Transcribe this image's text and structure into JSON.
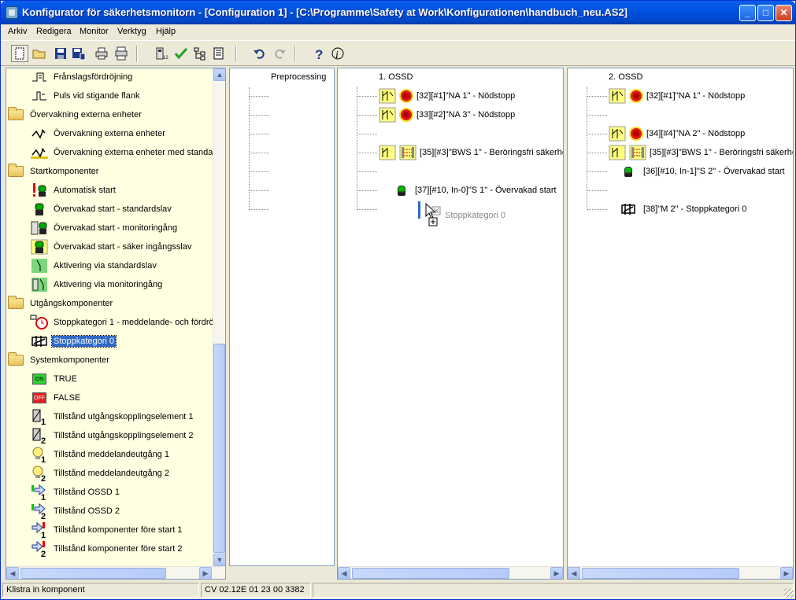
{
  "window": {
    "title": "Konfigurator för säkerhetsmonitorn - [Configuration 1] - [C:\\Programme\\Safety at Work\\Konfigurationen\\handbuch_neu.AS2]",
    "controls": {
      "minimize": "_",
      "maximize": "□",
      "close": "✕"
    }
  },
  "menu": [
    "Arkiv",
    "Redigera",
    "Monitor",
    "Verktyg",
    "Hjälp"
  ],
  "toolbar_icons": [
    "new-icon",
    "open-icon",
    "save-icon",
    "save-as-icon",
    "print-icon",
    "print-preview-icon",
    "monitor-icon",
    "check-icon",
    "tree-icon",
    "report-icon",
    "undo-icon",
    "redo-icon",
    "help-icon",
    "context-help-icon"
  ],
  "tree": {
    "items": [
      {
        "label": "Frånslagsfördröjning",
        "icon": "delay-icon",
        "level": 1
      },
      {
        "label": "Puls vid stigande flank",
        "icon": "pulse-icon",
        "level": 1
      },
      {
        "label": "Övervakning externa enheter",
        "icon": "folder-icon",
        "level": 0
      },
      {
        "label": "Övervakning externa enheter",
        "icon": "ext-monitor-icon",
        "level": 1
      },
      {
        "label": "Övervakning externa enheter med standa",
        "icon": "ext-monitor-std-icon",
        "level": 1
      },
      {
        "label": "Startkomponenter",
        "icon": "folder-icon",
        "level": 0
      },
      {
        "label": "Automatisk start",
        "icon": "auto-start-icon",
        "level": 1
      },
      {
        "label": "Övervakad start - standardslav",
        "icon": "start-light-icon",
        "level": 1
      },
      {
        "label": "Övervakad start - monitoringång",
        "icon": "start-monitor-icon",
        "level": 1
      },
      {
        "label": "Övervakad start - säker ingångsslav",
        "icon": "start-safe-icon",
        "level": 1
      },
      {
        "label": "Aktivering via standardslav",
        "icon": "activation-std-icon",
        "level": 1
      },
      {
        "label": "Aktivering via monitoringång",
        "icon": "activation-monitor-icon",
        "level": 1
      },
      {
        "label": "Utgångskomponenter",
        "icon": "folder-icon",
        "level": 0
      },
      {
        "label": "Stoppkategori 1 - meddelande- och fördrö",
        "icon": "stop-timer-icon",
        "level": 1
      },
      {
        "label": "Stoppkategori 0",
        "icon": "stop-category-icon",
        "level": 1,
        "selected": true
      },
      {
        "label": "Systemkomponenter",
        "icon": "folder-icon",
        "level": 0
      },
      {
        "label": "TRUE",
        "icon": "true-icon",
        "level": 1,
        "badge": "ON"
      },
      {
        "label": "FALSE",
        "icon": "false-icon",
        "level": 1,
        "badge": "OFF"
      },
      {
        "label": "Tillstånd utgångskopplingselement 1",
        "icon": "relay-1-icon",
        "level": 1
      },
      {
        "label": "Tillstånd utgångskopplingselement 2",
        "icon": "relay-2-icon",
        "level": 1
      },
      {
        "label": "Tillstånd meddelandeutgång 1",
        "icon": "bulb-1-icon",
        "level": 1
      },
      {
        "label": "Tillstånd meddelandeutgång 2",
        "icon": "bulb-2-icon",
        "level": 1
      },
      {
        "label": "Tillstånd OSSD 1",
        "icon": "ossd-1-icon",
        "level": 1
      },
      {
        "label": "Tillstånd OSSD 2",
        "icon": "ossd-2-icon",
        "level": 1
      },
      {
        "label": "Tillstånd komponenter före start 1",
        "icon": "prestart-1-icon",
        "level": 1
      },
      {
        "label": "Tillstånd komponenter före start 2",
        "icon": "prestart-2-icon",
        "level": 1
      }
    ]
  },
  "columns": {
    "preprocessing": {
      "title": "Preprocessing"
    },
    "ossd1": {
      "title": "1. OSSD",
      "nodes": [
        "[32][#1]\"NA 1\" - Nödstopp",
        "[33][#2]\"NA 3\" - Nödstopp",
        "[35][#3]\"BWS 1\" - Beröringsfri säkerhe",
        "[37][#10, In-0]\"S 1\" - Övervakad start"
      ],
      "dragging": "Stoppkategori 0"
    },
    "ossd2": {
      "title": "2. OSSD",
      "nodes": [
        "[32][#1]\"NA 1\" - Nödstopp",
        "[34][#4]\"NA 2\" - Nödstopp",
        "[35][#3]\"BWS 1\" - Beröringsfri säkerhe",
        "[36][#10, In-1]\"S 2\" - Övervakad start",
        "[38]\"M 2\" - Stoppkategori 0"
      ]
    }
  },
  "status": {
    "message": "Klistra in komponent",
    "version": "CV 02.12E 01 23 00 3382"
  },
  "colors": {
    "selection": "#316ac5",
    "tree_bg": "#ffffe1",
    "titlebar": "#0054e3"
  }
}
